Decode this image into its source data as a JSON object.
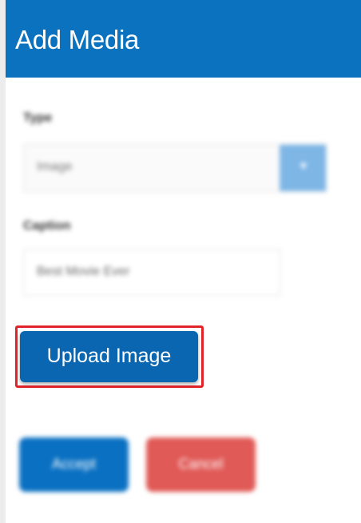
{
  "dialog": {
    "title": "Add Media"
  },
  "form": {
    "type_label": "Type",
    "type_value": "Image",
    "type_dropdown_icon": "chevron-down-icon",
    "caption_label": "Caption",
    "caption_value": "Best Movie Ever",
    "upload_label": "Upload Image"
  },
  "actions": {
    "accept_label": "Accept",
    "cancel_label": "Cancel"
  },
  "colors": {
    "header": "#0a72be",
    "primary": "#0a66b0",
    "danger": "#e05a57",
    "highlight": "#e0242a"
  }
}
